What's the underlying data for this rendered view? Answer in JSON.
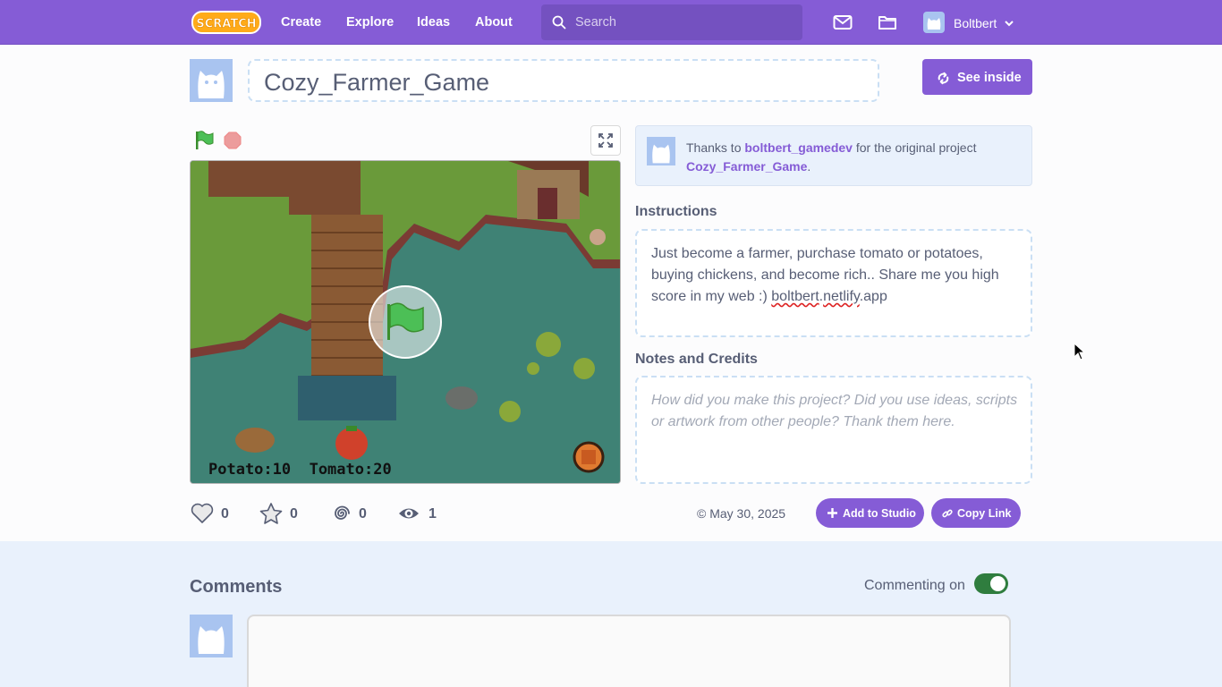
{
  "nav": {
    "logo_text": "SCRATCH",
    "links": [
      "Create",
      "Explore",
      "Ideas",
      "About"
    ],
    "search_placeholder": "Search",
    "username": "Boltbert",
    "icons": [
      "messages-icon",
      "my-stuff-folder-icon",
      "chevron-down-icon"
    ]
  },
  "project": {
    "title": "Cozy_Farmer_Game",
    "see_inside_label": "See inside",
    "remix_prefix": "Thanks to ",
    "remix_author": "boltbert_gamedev",
    "remix_middle": " for the original project ",
    "remix_project": "Cozy_Farmer_Game",
    "remix_suffix": ".",
    "instructions_heading": "Instructions",
    "instructions_a": "Just become a farmer, purchase tomato or potatoes, buying chickens, and become rich.. Share me you high score in my web :) ",
    "instructions_link_a": "boltbert",
    "instructions_dot": ".",
    "instructions_link_b": "netlify",
    "instructions_b": ".app",
    "notes_heading": "Notes and Credits",
    "notes_placeholder": "How did you make this project? Did you use ideas, scripts or artwork from other people? Thank them here.",
    "stage_hud": "Potato:10  Tomato:20",
    "stats": {
      "loves": "0",
      "favorites": "0",
      "remixes": "0",
      "views": "1"
    },
    "date": "May 30, 2025",
    "date_prefix": "©",
    "add_to_studio_label": "Add to Studio",
    "copy_link_label": "Copy Link"
  },
  "comments": {
    "heading": "Comments",
    "commenting_label": "Commenting on",
    "commenting_enabled": true
  },
  "colors": {
    "brand": "#855cd6",
    "nav_search_bg": "#7451c0",
    "toggle_on": "#2f7d3e",
    "comments_bg": "#e9f1fc"
  }
}
